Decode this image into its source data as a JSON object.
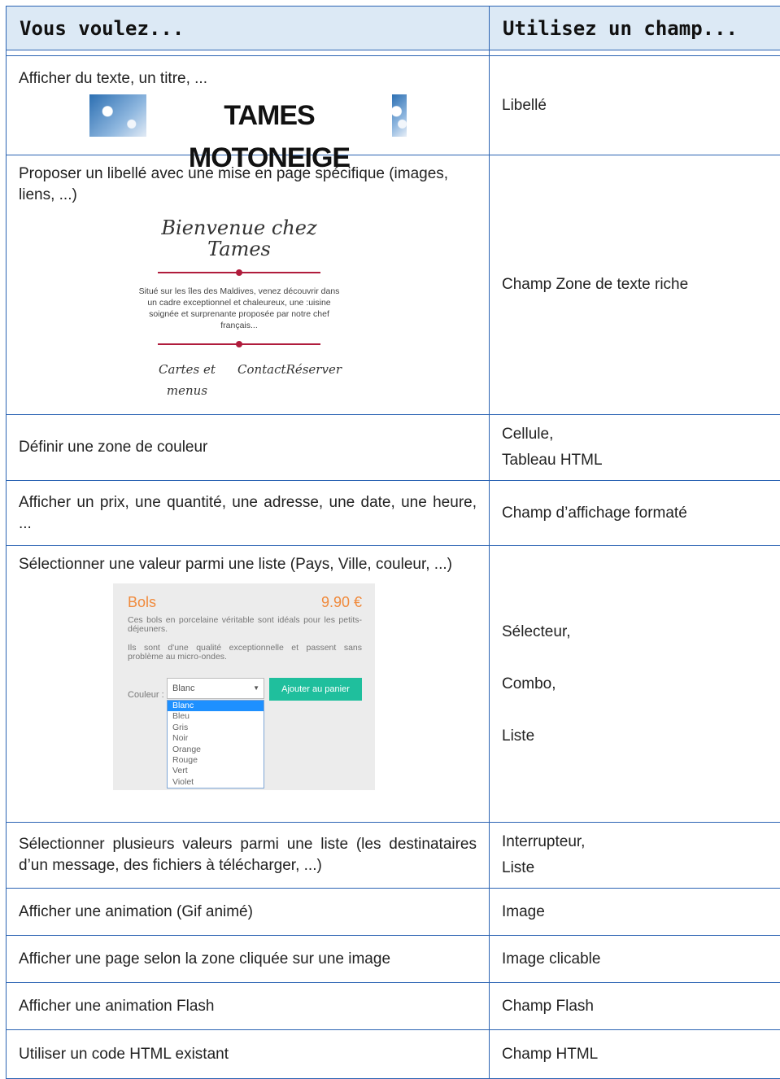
{
  "header": {
    "col1": "Vous voulez...",
    "col2": "Utilisez un champ..."
  },
  "rows": [
    {
      "left": "Afficher du texte, un titre, ...",
      "right": "Libellé"
    },
    {
      "left": "Proposer un libellé avec une mise en page spécifique (images, liens, ...)",
      "right": "Champ Zone de texte riche"
    },
    {
      "left": "Définir une zone de couleur",
      "right": [
        "Cellule,",
        "Tableau HTML"
      ]
    },
    {
      "left": "Afficher un prix, une quantité, une adresse, une date, une heure, ...",
      "right": "Champ d’affichage formaté"
    },
    {
      "left": "Sélectionner une valeur parmi une liste (Pays, Ville, couleur, ...)",
      "right": [
        "Sélecteur,",
        "Combo,",
        "Liste"
      ]
    },
    {
      "left": "Sélectionner plusieurs valeurs parmi une liste (les destinataires d’un message, des fichiers à télécharger, ...)",
      "right": [
        "Interrupteur,",
        "Liste"
      ]
    },
    {
      "left": "Afficher une animation (Gif animé)",
      "right": "Image"
    },
    {
      "left": "Afficher une page selon la zone cliquée sur une image",
      "right": "Image clicable"
    },
    {
      "left": "Afficher une animation Flash",
      "right": "Champ Flash"
    },
    {
      "left": "Utiliser un code HTML existant",
      "right": "Champ HTML"
    }
  ],
  "banner": {
    "text": "TAMES MOTONEIGE"
  },
  "welcome": {
    "title": "Bienvenue chez Tames",
    "text": "Situé sur les îles des Maldives, venez découvrir dans un cadre exceptionnel et chaleureux, une :uisine soignée et surprenante proposée par notre chef français...",
    "links": [
      "Cartes et menus",
      "Contact",
      "Réserver"
    ]
  },
  "product": {
    "title": "Bols",
    "price": "9.90 €",
    "desc1": "Ces bols en porcelaine véritable sont idéals pour les petits-déjeuners.",
    "desc2": "Ils sont d'une qualité exceptionnelle et passent sans problème au micro-ondes.",
    "color_label": "Couleur :",
    "selected": "Blanc",
    "button": "Ajouter au panier",
    "options": [
      "Blanc",
      "Bleu",
      "Gris",
      "Noir",
      "Orange",
      "Rouge",
      "Vert",
      "Violet"
    ]
  },
  "colors": {
    "border": "#2b63b3",
    "header_bg": "#dce9f5",
    "accent_orange": "#f08a3c",
    "button_teal": "#1fbf9d"
  }
}
